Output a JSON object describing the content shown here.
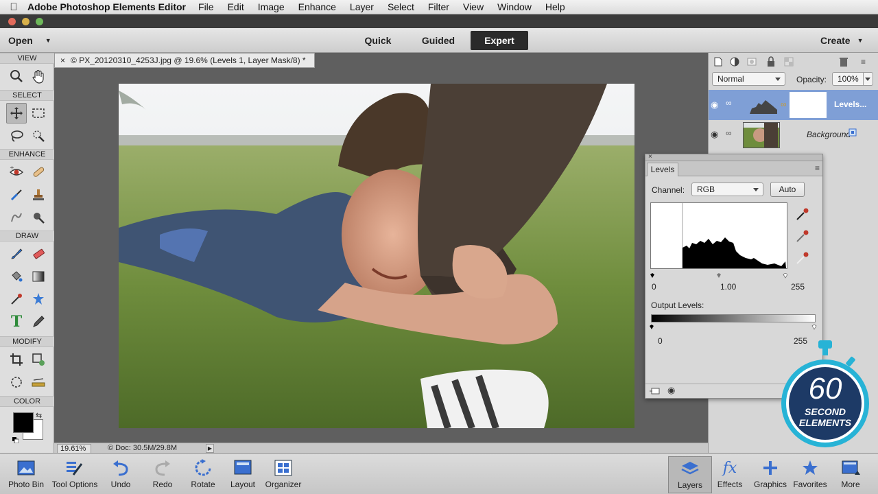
{
  "menubar": {
    "app_name": "Adobe Photoshop Elements Editor",
    "items": [
      "File",
      "Edit",
      "Image",
      "Enhance",
      "Layer",
      "Select",
      "Filter",
      "View",
      "Window",
      "Help"
    ]
  },
  "modebar": {
    "open_label": "Open",
    "modes": [
      "Quick",
      "Guided",
      "Expert"
    ],
    "active_mode": "Expert",
    "create_label": "Create"
  },
  "toolbox": {
    "sections": [
      "VIEW",
      "SELECT",
      "ENHANCE",
      "DRAW",
      "MODIFY",
      "COLOR"
    ]
  },
  "document": {
    "tab_close": "×",
    "tab_title": "© PX_20120310_4253J.jpg @ 19.6% (Levels 1, Layer Mask/8) *",
    "zoom": "19.61%",
    "doc_size": "© Doc: 30.5M/29.8M"
  },
  "layers_panel": {
    "blend_mode": "Normal",
    "opacity_label": "Opacity:",
    "opacity_value": "100%",
    "layers": [
      {
        "name": "Levels...",
        "selected": true
      },
      {
        "name": "Background",
        "selected": false
      }
    ]
  },
  "levels": {
    "tab_label": "Levels",
    "channel_label": "Channel:",
    "channel_value": "RGB",
    "auto_label": "Auto",
    "input_black": "0",
    "input_gamma": "1.00",
    "input_white": "255",
    "output_label": "Output Levels:",
    "output_black": "0",
    "output_white": "255"
  },
  "bottombar": {
    "left": [
      "Photo Bin",
      "Tool Options",
      "Undo",
      "Redo",
      "Rotate",
      "Layout",
      "Organizer"
    ],
    "right": [
      "Layers",
      "Effects",
      "Graphics",
      "Favorites",
      "More"
    ]
  },
  "badge": {
    "number": "60",
    "line1": "SECOND",
    "line2": "ELEMENTS"
  },
  "colors": {
    "accent": "#2b2b2b",
    "selected_layer": "#7f9fd6",
    "badge_ring": "#27b3d6",
    "badge_fill": "#1d3a66"
  }
}
